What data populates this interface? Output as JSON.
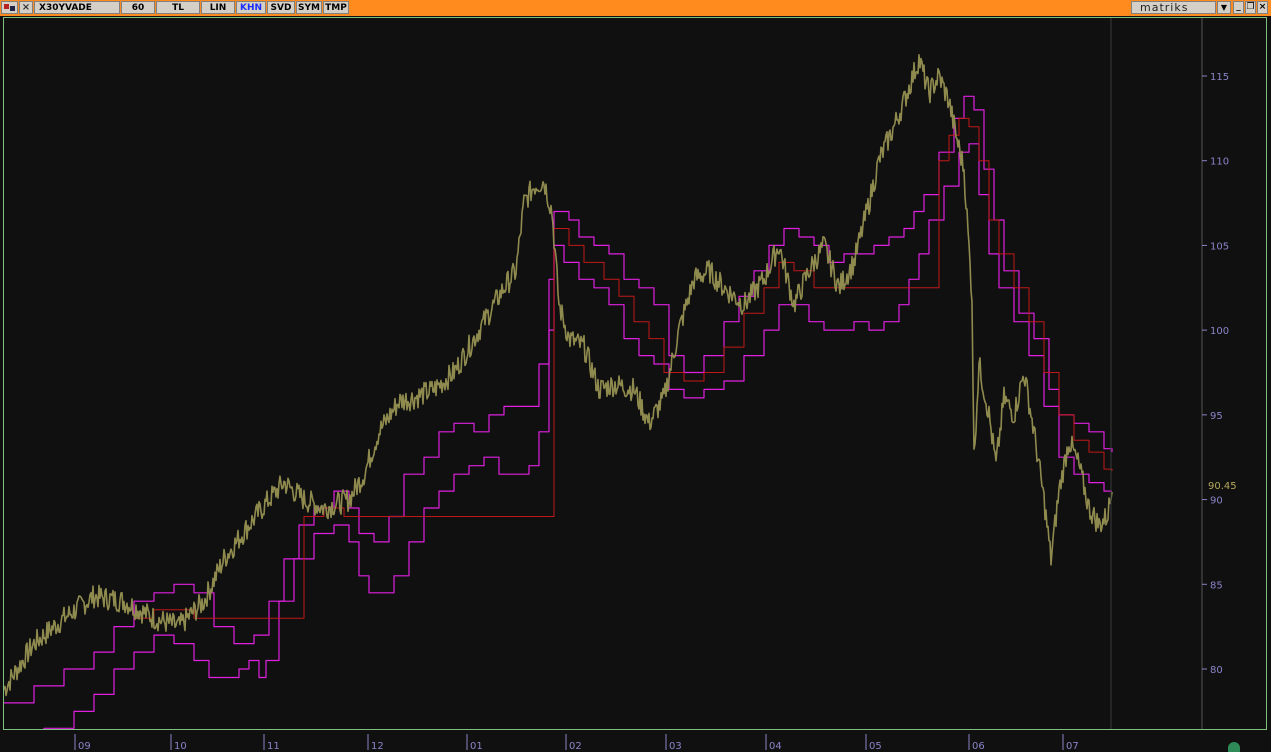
{
  "toolbar": {
    "symbol": "X30YVADE",
    "buttons": [
      {
        "label": "60"
      },
      {
        "label": "TL"
      },
      {
        "label": "LIN"
      },
      {
        "label": "KHN"
      },
      {
        "label": "SVD"
      },
      {
        "label": "SYM"
      },
      {
        "label": "TMP"
      }
    ],
    "active_button": "KHN",
    "brand": "matriks"
  },
  "colors": {
    "toolbar_bg": "#ff8a1e",
    "chart_bg": "#101010",
    "price_line": "#8f8a4e",
    "band_line": "#e020e0",
    "mid_line": "#c01818",
    "axis_text": "#8a84c8",
    "last_value_text": "#b5a85a"
  },
  "chart_data": {
    "type": "line",
    "ylim": [
      76.5,
      117.5
    ],
    "y_ticks": [
      80,
      85,
      90,
      95,
      100,
      105,
      110,
      115
    ],
    "x_tick_labels": [
      "09",
      "10",
      "11",
      "12",
      "01",
      "02",
      "03",
      "04",
      "05",
      "06",
      "07"
    ],
    "x_tick_positions": [
      75,
      171,
      264,
      368,
      467,
      566,
      666,
      766,
      866,
      969,
      1063
    ],
    "last_value_label": "90.45",
    "last_value": 90.45,
    "series": [
      {
        "key": "price",
        "points": [
          [
            0,
            78.8
          ],
          [
            30,
            81.5
          ],
          [
            60,
            83.0
          ],
          [
            90,
            84.3
          ],
          [
            120,
            84.0
          ],
          [
            150,
            83.0
          ],
          [
            175,
            82.5
          ],
          [
            200,
            84.0
          ],
          [
            220,
            86.5
          ],
          [
            245,
            88.5
          ],
          [
            265,
            90.0
          ],
          [
            280,
            91.0
          ],
          [
            300,
            90.0
          ],
          [
            320,
            89.5
          ],
          [
            345,
            90.0
          ],
          [
            360,
            91.5
          ],
          [
            375,
            94.0
          ],
          [
            395,
            95.8
          ],
          [
            410,
            96.0
          ],
          [
            430,
            96.5
          ],
          [
            450,
            97.5
          ],
          [
            465,
            99.0
          ],
          [
            485,
            101.0
          ],
          [
            500,
            102.5
          ],
          [
            512,
            103.5
          ],
          [
            520,
            107.5
          ],
          [
            530,
            108.5
          ],
          [
            540,
            108.8
          ],
          [
            548,
            107.0
          ],
          [
            555,
            101.5
          ],
          [
            565,
            99.5
          ],
          [
            580,
            99.0
          ],
          [
            595,
            96.5
          ],
          [
            610,
            96.8
          ],
          [
            630,
            96.5
          ],
          [
            645,
            94.5
          ],
          [
            660,
            96.0
          ],
          [
            675,
            100.0
          ],
          [
            690,
            103.0
          ],
          [
            705,
            103.5
          ],
          [
            720,
            102.5
          ],
          [
            740,
            101.5
          ],
          [
            760,
            103.0
          ],
          [
            775,
            105.0
          ],
          [
            790,
            101.5
          ],
          [
            805,
            103.5
          ],
          [
            820,
            105.0
          ],
          [
            835,
            102.5
          ],
          [
            850,
            104.0
          ],
          [
            865,
            107.5
          ],
          [
            875,
            110.0
          ],
          [
            890,
            112.0
          ],
          [
            900,
            113.5
          ],
          [
            915,
            116.0
          ],
          [
            925,
            114.0
          ],
          [
            935,
            115.0
          ],
          [
            945,
            113.5
          ],
          [
            952,
            111.5
          ],
          [
            960,
            109.5
          ],
          [
            968,
            102.0
          ],
          [
            970,
            92.5
          ],
          [
            975,
            98.0
          ],
          [
            985,
            95.0
          ],
          [
            992,
            92.0
          ],
          [
            1000,
            96.0
          ],
          [
            1010,
            95.0
          ],
          [
            1020,
            97.5
          ],
          [
            1030,
            94.0
          ],
          [
            1040,
            90.0
          ],
          [
            1047,
            86.5
          ],
          [
            1055,
            90.5
          ],
          [
            1065,
            93.5
          ],
          [
            1075,
            92.0
          ],
          [
            1085,
            89.5
          ],
          [
            1095,
            88.5
          ],
          [
            1103,
            89.0
          ],
          [
            1108,
            90.45
          ]
        ]
      },
      {
        "key": "upper",
        "points": [
          [
            0,
            78.0
          ],
          [
            20,
            78.0
          ],
          [
            30,
            79.0
          ],
          [
            60,
            80.0
          ],
          [
            90,
            81.0
          ],
          [
            110,
            82.5
          ],
          [
            130,
            84.0
          ],
          [
            150,
            84.5
          ],
          [
            170,
            85.0
          ],
          [
            190,
            84.5
          ],
          [
            210,
            82.5
          ],
          [
            230,
            81.5
          ],
          [
            250,
            82.0
          ],
          [
            265,
            84.0
          ],
          [
            280,
            86.5
          ],
          [
            295,
            88.5
          ],
          [
            310,
            89.5
          ],
          [
            330,
            90.5
          ],
          [
            345,
            89.5
          ],
          [
            355,
            88.0
          ],
          [
            370,
            87.5
          ],
          [
            385,
            89.0
          ],
          [
            400,
            91.5
          ],
          [
            420,
            92.5
          ],
          [
            435,
            94.0
          ],
          [
            450,
            94.5
          ],
          [
            470,
            94.0
          ],
          [
            485,
            95.0
          ],
          [
            500,
            95.5
          ],
          [
            520,
            95.5
          ],
          [
            535,
            98.0
          ],
          [
            545,
            103.0
          ],
          [
            550,
            107.0
          ],
          [
            565,
            106.5
          ],
          [
            575,
            105.5
          ],
          [
            590,
            105.0
          ],
          [
            605,
            104.5
          ],
          [
            620,
            103.0
          ],
          [
            635,
            102.5
          ],
          [
            650,
            101.5
          ],
          [
            665,
            98.5
          ],
          [
            680,
            97.5
          ],
          [
            700,
            98.5
          ],
          [
            720,
            100.5
          ],
          [
            735,
            102.0
          ],
          [
            750,
            103.5
          ],
          [
            765,
            105.0
          ],
          [
            780,
            106.0
          ],
          [
            795,
            105.5
          ],
          [
            810,
            105.0
          ],
          [
            825,
            104.0
          ],
          [
            840,
            104.5
          ],
          [
            855,
            104.5
          ],
          [
            870,
            105.0
          ],
          [
            885,
            105.5
          ],
          [
            900,
            106.0
          ],
          [
            910,
            107.0
          ],
          [
            920,
            108.0
          ],
          [
            935,
            110.5
          ],
          [
            950,
            112.5
          ],
          [
            960,
            113.8
          ],
          [
            970,
            113.0
          ],
          [
            980,
            109.5
          ],
          [
            990,
            106.5
          ],
          [
            1000,
            103.5
          ],
          [
            1015,
            101.0
          ],
          [
            1030,
            99.5
          ],
          [
            1045,
            96.5
          ],
          [
            1055,
            95.0
          ],
          [
            1070,
            94.5
          ],
          [
            1085,
            94.0
          ],
          [
            1100,
            93.0
          ],
          [
            1108,
            92.8
          ]
        ]
      },
      {
        "key": "lower",
        "points": [
          [
            0,
            76.3
          ],
          [
            40,
            76.5
          ],
          [
            70,
            77.5
          ],
          [
            90,
            78.5
          ],
          [
            110,
            80.0
          ],
          [
            130,
            81.0
          ],
          [
            150,
            82.0
          ],
          [
            170,
            81.5
          ],
          [
            190,
            80.5
          ],
          [
            205,
            79.5
          ],
          [
            220,
            79.5
          ],
          [
            235,
            80.0
          ],
          [
            245,
            80.5
          ],
          [
            255,
            79.5
          ],
          [
            262,
            80.5
          ],
          [
            275,
            84.0
          ],
          [
            290,
            86.5
          ],
          [
            310,
            88.0
          ],
          [
            330,
            88.5
          ],
          [
            345,
            87.5
          ],
          [
            355,
            85.5
          ],
          [
            365,
            84.5
          ],
          [
            375,
            84.5
          ],
          [
            390,
            85.5
          ],
          [
            405,
            87.5
          ],
          [
            420,
            89.5
          ],
          [
            435,
            90.5
          ],
          [
            450,
            91.5
          ],
          [
            465,
            92.0
          ],
          [
            480,
            92.5
          ],
          [
            495,
            91.5
          ],
          [
            510,
            91.5
          ],
          [
            525,
            92.0
          ],
          [
            535,
            94.0
          ],
          [
            545,
            100.0
          ],
          [
            550,
            105.0
          ],
          [
            560,
            104.0
          ],
          [
            575,
            103.0
          ],
          [
            590,
            102.5
          ],
          [
            605,
            101.5
          ],
          [
            620,
            99.5
          ],
          [
            635,
            98.5
          ],
          [
            650,
            98.0
          ],
          [
            665,
            96.5
          ],
          [
            680,
            96.0
          ],
          [
            700,
            96.5
          ],
          [
            720,
            97.0
          ],
          [
            740,
            98.5
          ],
          [
            760,
            100.0
          ],
          [
            775,
            101.5
          ],
          [
            790,
            101.5
          ],
          [
            805,
            100.5
          ],
          [
            820,
            100.0
          ],
          [
            835,
            100.0
          ],
          [
            850,
            100.5
          ],
          [
            865,
            100.0
          ],
          [
            880,
            100.5
          ],
          [
            895,
            101.5
          ],
          [
            905,
            103.0
          ],
          [
            915,
            104.5
          ],
          [
            925,
            106.5
          ],
          [
            940,
            108.5
          ],
          [
            955,
            110.5
          ],
          [
            965,
            111.0
          ],
          [
            975,
            108.0
          ],
          [
            985,
            104.5
          ],
          [
            995,
            102.5
          ],
          [
            1010,
            100.5
          ],
          [
            1025,
            98.5
          ],
          [
            1040,
            95.5
          ],
          [
            1055,
            92.5
          ],
          [
            1070,
            91.5
          ],
          [
            1085,
            91.0
          ],
          [
            1100,
            90.5
          ],
          [
            1108,
            90.5
          ]
        ]
      },
      {
        "key": "middle",
        "points": [
          [
            130,
            83.0
          ],
          [
            150,
            83.5
          ],
          [
            170,
            83.5
          ],
          [
            190,
            83.0
          ],
          [
            300,
            89.0
          ],
          [
            320,
            89.5
          ],
          [
            340,
            89.0
          ],
          [
            550,
            106.0
          ],
          [
            565,
            105.0
          ],
          [
            580,
            104.0
          ],
          [
            600,
            103.0
          ],
          [
            615,
            102.0
          ],
          [
            630,
            100.5
          ],
          [
            645,
            99.5
          ],
          [
            660,
            97.5
          ],
          [
            680,
            97.0
          ],
          [
            700,
            97.5
          ],
          [
            720,
            99.0
          ],
          [
            740,
            101.0
          ],
          [
            760,
            102.5
          ],
          [
            775,
            104.0
          ],
          [
            790,
            103.5
          ],
          [
            810,
            102.5
          ],
          [
            830,
            102.5
          ],
          [
            850,
            102.5
          ],
          [
            935,
            110.0
          ],
          [
            945,
            111.5
          ],
          [
            955,
            112.5
          ],
          [
            965,
            112.0
          ],
          [
            975,
            110.0
          ],
          [
            985,
            106.5
          ],
          [
            995,
            104.5
          ],
          [
            1010,
            102.5
          ],
          [
            1025,
            100.5
          ],
          [
            1040,
            97.5
          ],
          [
            1055,
            95.0
          ],
          [
            1070,
            93.5
          ],
          [
            1085,
            92.8
          ],
          [
            1100,
            91.8
          ],
          [
            1108,
            91.7
          ]
        ]
      }
    ]
  }
}
